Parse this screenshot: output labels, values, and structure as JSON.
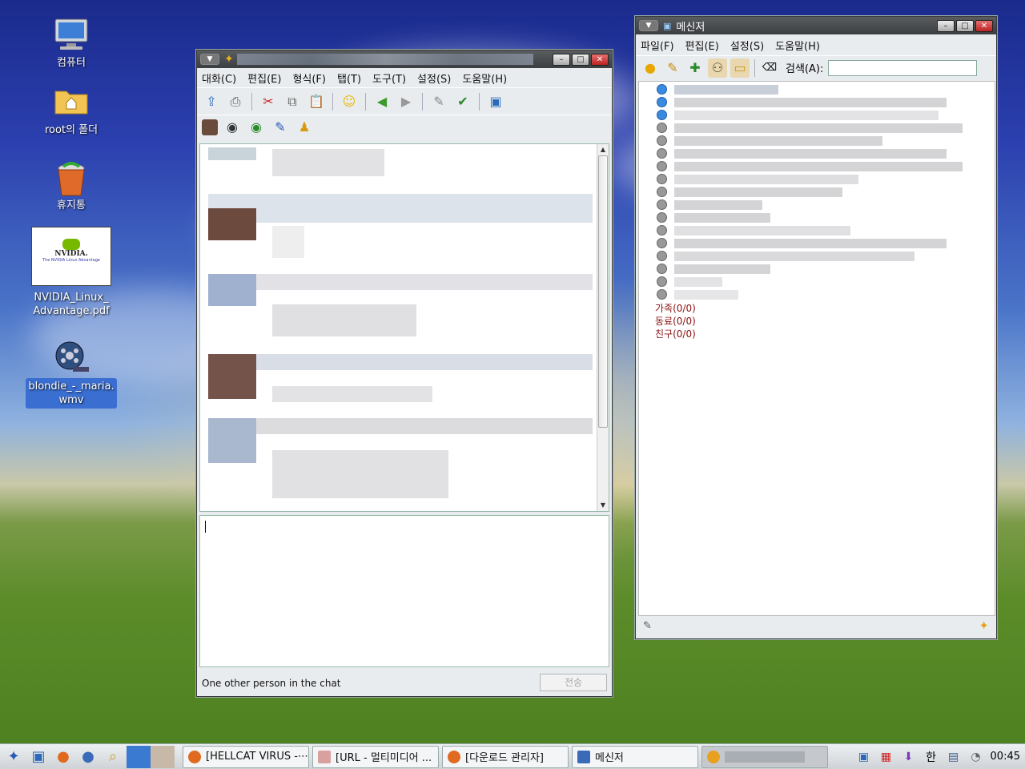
{
  "desktop": {
    "icons": [
      {
        "label": "컴퓨터"
      },
      {
        "label": "root의 폴더"
      },
      {
        "label": "휴지통"
      },
      {
        "label": "NVIDIA_Linux_\nAdvantage.pdf",
        "line1": "NVIDIA_Linux_",
        "line2": "Advantage.pdf",
        "thumb_text": "NVIDIA.",
        "thumb_sub": "The NVIDIA Linux Advantage"
      },
      {
        "label": "blondie_-_maria.wmv",
        "line1": "blondie_-_maria.",
        "line2": "wmv"
      }
    ]
  },
  "chat_window": {
    "menu": [
      "대화(C)",
      "편집(E)",
      "형식(F)",
      "탭(T)",
      "도구(T)",
      "설정(S)",
      "도움말(H)"
    ],
    "status_text": "One other person in the chat",
    "send_label": "전송",
    "toolbar_icons": [
      "send-file-icon",
      "print-icon",
      "cut-icon",
      "copy-icon",
      "paste-icon",
      "emoticon-icon",
      "back-arrow-icon",
      "forward-arrow-icon",
      "pen-icon",
      "spellcheck-icon",
      "messenger-icon"
    ],
    "toolbar2_icons": [
      "photo-icon",
      "webcam-icon",
      "voice-icon",
      "link-icon",
      "bell-icon"
    ]
  },
  "messenger_window": {
    "title": "메신저",
    "menu": [
      "파일(F)",
      "편집(E)",
      "설정(S)",
      "도움말(H)"
    ],
    "search_label": "검색(A):",
    "search_value": "",
    "groups": [
      {
        "name": "가족",
        "count": "(0/0)"
      },
      {
        "name": "동료",
        "count": "(0/0)"
      },
      {
        "name": "친구",
        "count": "(0/0)"
      }
    ],
    "contact_status": [
      "online",
      "online",
      "online",
      "offline",
      "offline",
      "offline",
      "offline",
      "offline",
      "offline",
      "offline",
      "offline",
      "offline",
      "offline",
      "offline",
      "offline",
      "offline",
      "offline"
    ]
  },
  "taskbar": {
    "tasks": [
      {
        "label": "[HELLCAT VIRUS -⋯"
      },
      {
        "label": "[URL - 멀티미디어 ..."
      },
      {
        "label": "[다운로드 관리자]"
      },
      {
        "label": "메신저"
      },
      {
        "label": ""
      }
    ],
    "tray_ime": "한",
    "clock": "00:45"
  },
  "colors": {
    "selection": "#3a6ed0",
    "group_text": "#8a1010",
    "online_status": "#3a8be0",
    "close_button": "#c33"
  }
}
